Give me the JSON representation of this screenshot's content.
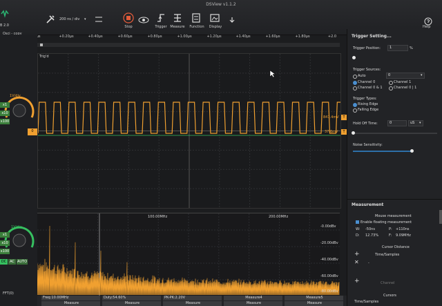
{
  "window_title": "DSView v1.1.2",
  "toolbar": {
    "version": "B 2.0",
    "timebase": "200 ns / div",
    "buttons": [
      {
        "label": "Stop",
        "icon": "stop-icon"
      },
      {
        "label": "Trigger",
        "icon": "trigger-icon"
      },
      {
        "label": "Measure",
        "icon": "measure-icon"
      },
      {
        "label": "Function",
        "icon": "function-icon"
      },
      {
        "label": "Display",
        "icon": "display-icon"
      }
    ],
    "help": "Help",
    "mode": "Osci - copy"
  },
  "ruler_ticks": [
    "0μs",
    "+0.20μs",
    "+0.40μs",
    "+0.60μs",
    "+0.80μs",
    "+1.00μs",
    "+1.20μs",
    "+1.40μs",
    "+1.60μs",
    "+1.80μs",
    "+2.0"
  ],
  "scope": {
    "trig_label": "Trig'd",
    "level_right_upper": "847.4mV",
    "level_right_lower": "37.6mV",
    "ch0": {
      "scale": "1V/div",
      "coupling": [
        "x1",
        "x10",
        "x100"
      ]
    },
    "ch1": {
      "scale": "1V/div",
      "coupling": [
        "x1",
        "x10",
        "x100"
      ],
      "modes": [
        "DC",
        "AC",
        "AUTO"
      ]
    }
  },
  "fft": {
    "label": "FFT(0)",
    "freq_labels": [
      "100.00MHz",
      "200.00MHz"
    ],
    "db_labels": [
      "-0.00dBv",
      "-20.00dBv",
      "-40.00dBv",
      "-60.00dBv",
      "-80.00dBv"
    ]
  },
  "status_bar": {
    "row1": [
      "Freq:10.00MHz",
      "Duty:54.60%",
      "PK-PK:2.20V",
      "Measure4",
      "Measure5"
    ],
    "row2": [
      "Measure",
      "Measure",
      "Measure",
      "Measure",
      "Measure"
    ]
  },
  "trigger_panel": {
    "title": "Trigger Setting...",
    "position_label": "Trigger Position:",
    "position_value": "1",
    "position_unit": "%",
    "position_fraction": 0.01,
    "sources_label": "Trigger Sources:",
    "auto_label": "Auto",
    "source_value": "0",
    "channel0": "Channel 0",
    "channel1": "Channel 1",
    "channel0and1": "Channel 0 & 1",
    "channel0or1": "Channel 0 | 1",
    "types_label": "Trigger Types:",
    "rising": "Rising Edge",
    "falling": "Falling Edge",
    "holdoff_label": "Hold Off Time:",
    "holdoff_value": "0",
    "holdoff_unit": "uS",
    "noise_label": "Noise Sensitivity:",
    "noise_fraction": 0.7
  },
  "measure_panel": {
    "title": "Measurement",
    "mouse_title": "Mouse measurement",
    "enable_label": "Enable floating measurement",
    "w": "W:",
    "w_val": "-50ns",
    "p": "P:",
    "p_val": "+110ns",
    "d": "D:",
    "d_val": "12.73%",
    "f": "F:",
    "f_val": "9.09MHz",
    "cursor_title": "Cursor Distance",
    "time_samples": "Time/Samples",
    "channel_label": "Channel",
    "cursors_title": "Cursors",
    "time_samples2": "Time/Samples"
  },
  "colors": {
    "ch0": "#f0a030",
    "ch1": "#36c060",
    "accent": "#4a8fd0",
    "stop": "#e25b3a"
  }
}
